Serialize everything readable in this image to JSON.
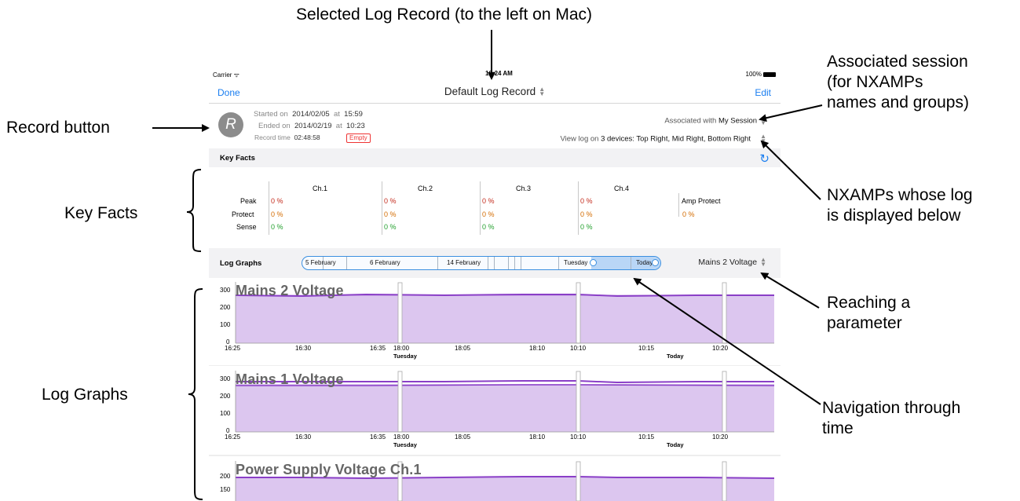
{
  "annotations": {
    "selected_log_record": "Selected Log Record (to the left on Mac)",
    "associated_session": [
      "Associated session",
      "(for NXAMPs",
      "names and groups)"
    ],
    "record_button": "Record button",
    "nxamps_log": [
      "NXAMPs whose log",
      "is displayed below"
    ],
    "key_facts": "Key Facts",
    "reaching_parameter": [
      "Reaching a",
      "parameter"
    ],
    "log_graphs": "Log Graphs",
    "navigation": [
      "Navigation through",
      "time"
    ]
  },
  "status_bar": {
    "carrier": "Carrier ᯤ",
    "time": "10:24 AM",
    "battery": "100%"
  },
  "navbar": {
    "done": "Done",
    "title": "Default Log Record",
    "edit": "Edit"
  },
  "record": {
    "button_letter": "R",
    "started_label": "Started on",
    "started_date": "2014/02/05",
    "at1": "at",
    "started_time": "15:59",
    "ended_label": "Ended on",
    "ended_date": "2014/02/19",
    "at2": "at",
    "ended_time": "10:23",
    "record_time_label": "Record time",
    "record_time": "02:48:58",
    "empty_badge": "Empty",
    "associated_label": "Associated with",
    "associated_value": "My Session",
    "view_label": "View log on",
    "view_value": "3 devices: Top Right, Mid Right, Bottom Right"
  },
  "key_facts": {
    "header": "Key Facts",
    "channels": [
      "Ch.1",
      "Ch.2",
      "Ch.3",
      "Ch.4"
    ],
    "amp_protect_label": "Amp Protect",
    "amp_protect_value": "0 %",
    "rows": [
      {
        "label": "Peak",
        "values": [
          "0 %",
          "0 %",
          "0 %",
          "0 %"
        ],
        "color": "#c42b1c"
      },
      {
        "label": "Protect",
        "values": [
          "0 %",
          "0 %",
          "0 %",
          "0 %"
        ],
        "color": "#d36b00"
      },
      {
        "label": "Sense",
        "values": [
          "0 %",
          "0 %",
          "0 %",
          "0 %"
        ],
        "color": "#22a02d"
      }
    ]
  },
  "log_graphs": {
    "header": "Log Graphs",
    "timeline_labels": [
      "5 February",
      "6 February",
      "14 February",
      "Tuesday",
      "Today"
    ],
    "parameter": "Mains 2 Voltage",
    "x_ticks": [
      "16:25",
      "16:30",
      "16:35",
      "18:00",
      "18:05",
      "18:10",
      "10:10",
      "10:15",
      "10:20"
    ],
    "day_labels": [
      "Tuesday",
      "Today"
    ],
    "graphs": [
      {
        "title": "Mains 2 Voltage",
        "y_ticks": [
          "300",
          "200",
          "100",
          "0"
        ]
      },
      {
        "title": "Mains 1 Voltage",
        "y_ticks": [
          "300",
          "200",
          "100",
          "0"
        ]
      },
      {
        "title": "Power Supply Voltage Ch.1",
        "y_ticks": [
          "200",
          "150"
        ]
      }
    ]
  },
  "colors": {
    "accent": "#1a7ef0",
    "graph_fill": "#dcc6ef",
    "graph_line": "#8a3fc7"
  }
}
